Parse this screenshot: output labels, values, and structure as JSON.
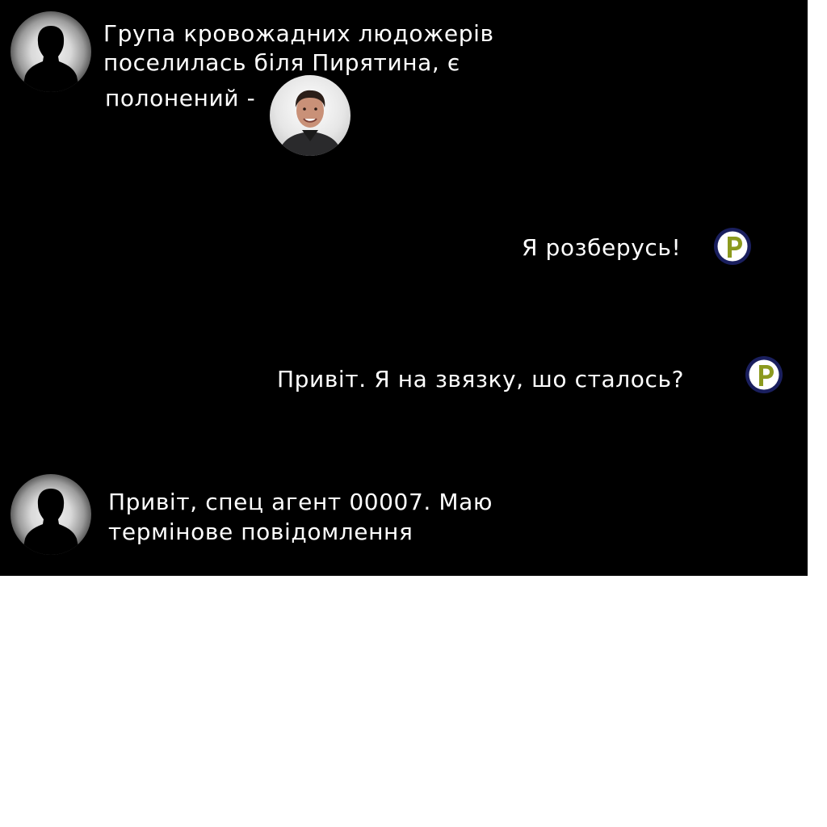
{
  "messages": [
    {
      "sender": "unknown",
      "line1": "Група кровожадних людожерів",
      "line2": "поселилась біля Пирятина, є",
      "line3": "полонений -"
    },
    {
      "sender": "agent",
      "text": "Я розберусь!"
    },
    {
      "sender": "agent",
      "text": "Привіт. Я на звязку, шо сталось?"
    },
    {
      "sender": "unknown",
      "line1": "Привіт, спец агент 00007. Маю",
      "line2": "термінове повідомлення"
    }
  ],
  "icons": {
    "unknown_avatar": "person-silhouette-icon",
    "prisoner_photo": "prisoner-photo",
    "agent_badge": "p-letter-icon"
  },
  "colors": {
    "chat_background": "#000000",
    "page_background": "#ffffff",
    "text": "#ffffff",
    "badge_ring": "#1a1f5e",
    "badge_letter": "#8c9a1e"
  }
}
